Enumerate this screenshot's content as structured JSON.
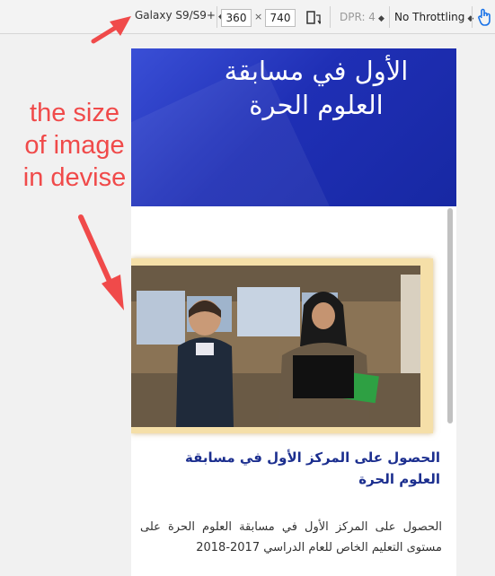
{
  "toolbar": {
    "device": "Galaxy S9/S9+",
    "width": "360",
    "times": "×",
    "height": "740",
    "dpr": "DPR: 4",
    "throttling": "No Throttling"
  },
  "page": {
    "hero_title": "الأول في مسابقة العلوم الحرة",
    "post_title": "الحصول على المركز الأول في مسابقة العلوم الحرة",
    "post_body": "الحصول على المركز الأول في مسابقة العلوم الحرة على مستوى التعليم الخاص للعام الدراسي 2017-2018"
  },
  "annotation": {
    "text": "the size of image in devise",
    "color": "#f04a4a"
  },
  "colors": {
    "hero": "#1f2fb5",
    "title": "#1c2f8f",
    "frame": "#f5dfa8"
  }
}
